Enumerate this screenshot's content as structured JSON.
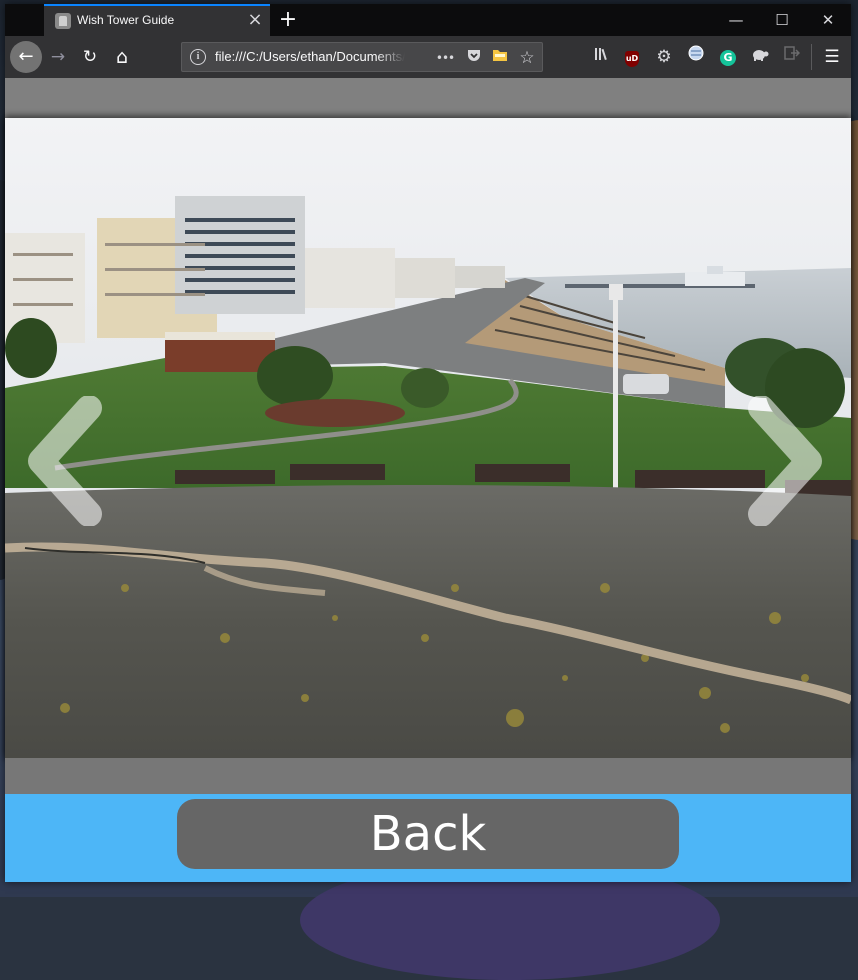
{
  "browser": {
    "tab": {
      "title": "Wish Tower Guide",
      "favicon": "tower-favicon"
    },
    "new_tab_label": "+",
    "window_controls": {
      "minimize": "—",
      "maximize": "☐",
      "close": "✕"
    },
    "toolbar": {
      "back": "←",
      "forward": "→",
      "reload": "↻",
      "home": "⌂",
      "url": "file:///C:/Users/ethan/Documents/",
      "page_actions": "•••",
      "menu": "☰"
    },
    "extensions": [
      "library-icon",
      "ublock-icon",
      "gear-icon",
      "globe-icon",
      "grammarly-icon",
      "turtle-icon",
      "exit-icon"
    ],
    "extension_labels": {
      "ublock": "uD",
      "grammarly": "G"
    }
  },
  "gallery": {
    "image_alt": "View from Wish Tower over Eastbourne seafront and pier",
    "prev_icon": "chevron-left-icon",
    "next_icon": "chevron-right-icon"
  },
  "footer": {
    "back_label": "Back"
  },
  "colors": {
    "tab_accent": "#0a84ff",
    "footer_bg": "#4db6f7",
    "back_button_bg": "#666666"
  }
}
